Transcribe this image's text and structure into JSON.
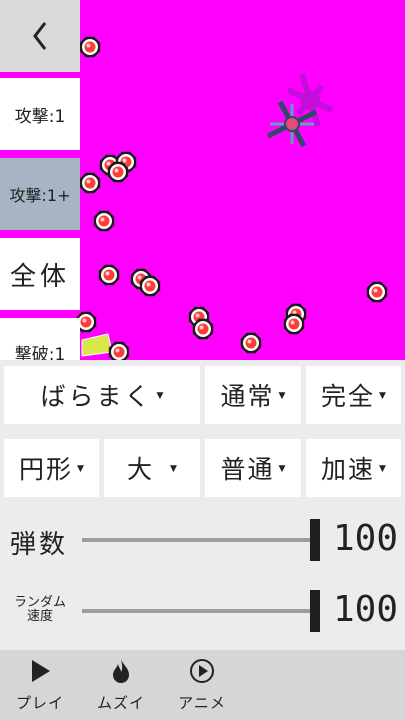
{
  "colors": {
    "stage_bg": "#ff00ff",
    "bullet_core": "#ff3b3b",
    "bullet_ring": "#ffffff",
    "selected_tab": "#a6b4c4"
  },
  "sidebar": {
    "back_icon": "chevron-left-icon",
    "attack1": "攻撃:1",
    "attack1_plus": "攻撃:1+",
    "all": "全体",
    "kill": "撃破:1"
  },
  "controls": {
    "row1": {
      "pattern": "ばらまく",
      "mode": "通常",
      "completion": "完全"
    },
    "row2": {
      "shape": "円形",
      "size": "大",
      "speed": "普通",
      "accel": "加速"
    },
    "bullet_count": {
      "label": "弾数",
      "value": "100",
      "level": 1.0
    },
    "random_speed": {
      "label_line1": "ランダム",
      "label_line2": "速度",
      "value": "100",
      "level": 1.0
    }
  },
  "tabs": [
    {
      "label": "プレイ",
      "icon": "play-icon"
    },
    {
      "label": "ムズイ",
      "icon": "flame-icon"
    },
    {
      "label": "アニメ",
      "icon": "play-circle-icon"
    }
  ]
}
